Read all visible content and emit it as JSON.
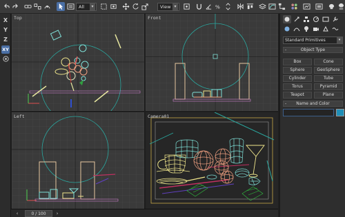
{
  "toolbar": {
    "selection_filter": "All",
    "coord_system": "View",
    "selection_filter_caret": "▾",
    "coord_system_caret": "▾"
  },
  "axis_strip": {
    "items": [
      "X",
      "Y",
      "Z",
      "XY"
    ]
  },
  "viewports": {
    "top": {
      "label": "Top"
    },
    "front": {
      "label": "Front"
    },
    "left": {
      "label": "Left"
    },
    "camera": {
      "label": "Camera01"
    }
  },
  "timeline": {
    "frame_text": "0 / 100"
  },
  "command_panel": {
    "category_dropdown": "Standard Primitives",
    "dropdown_caret": "▾",
    "object_type_header": "Object Type",
    "object_type_sign": "-",
    "object_buttons": [
      "Box",
      "Cone",
      "Sphere",
      "GeoSphere",
      "Cylinder",
      "Tube",
      "Torus",
      "Pyramid",
      "Teapot",
      "Plane"
    ],
    "name_color_header": "Name and Color",
    "name_color_sign": "-",
    "name_value": ""
  },
  "colors": {
    "accent_active": "#4a6fa5",
    "viewport_bg": "#3b3b3b",
    "grid": "#4a4a4a",
    "active_border": "#d8c84a",
    "wire_yellow": "#f0e68c",
    "wire_cyan": "#7fe0d8",
    "wire_orange": "#f0a080",
    "camera_cyan": "#2aa8a0"
  },
  "icons": [
    "undo-icon",
    "redo-icon",
    "link-icon",
    "unlink-icon",
    "bind-space-warp-icon",
    "select-icon",
    "select-by-name-icon",
    "region-select-icon",
    "window-crossing-icon",
    "move-icon",
    "rotate-icon",
    "scale-icon",
    "pivot-icon",
    "snap-icon",
    "mirror-icon",
    "align-icon",
    "layer-icon",
    "curve-editor-icon",
    "render-setup-icon",
    "render-frame-icon",
    "render-icon"
  ]
}
